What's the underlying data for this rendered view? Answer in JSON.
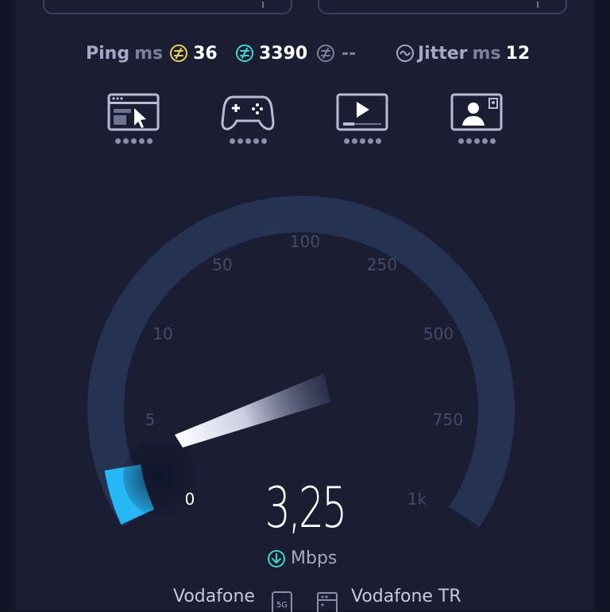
{
  "metrics": {
    "ping": {
      "label": "Ping",
      "unit": "ms",
      "value": "36"
    },
    "download": {
      "value": "3390"
    },
    "upload": {
      "value": "--"
    },
    "jitter": {
      "label": "Jitter",
      "unit": "ms",
      "value": "12"
    }
  },
  "apps": [
    {
      "icon": "web-browsing-icon",
      "rating": 5
    },
    {
      "icon": "gaming-icon",
      "rating": 5
    },
    {
      "icon": "video-streaming-icon",
      "rating": 5
    },
    {
      "icon": "video-call-icon",
      "rating": 5
    }
  ],
  "gauge": {
    "ticks": [
      "0",
      "5",
      "10",
      "50",
      "100",
      "250",
      "500",
      "750",
      "1k"
    ],
    "current_speed": "3,25",
    "unit": "Mbps",
    "accent_color": "#27b7f5",
    "track_color": "#253252"
  },
  "connection": {
    "provider_left": "Vodafone",
    "network_badge": "5G",
    "provider_right": "Vodafone TR"
  }
}
